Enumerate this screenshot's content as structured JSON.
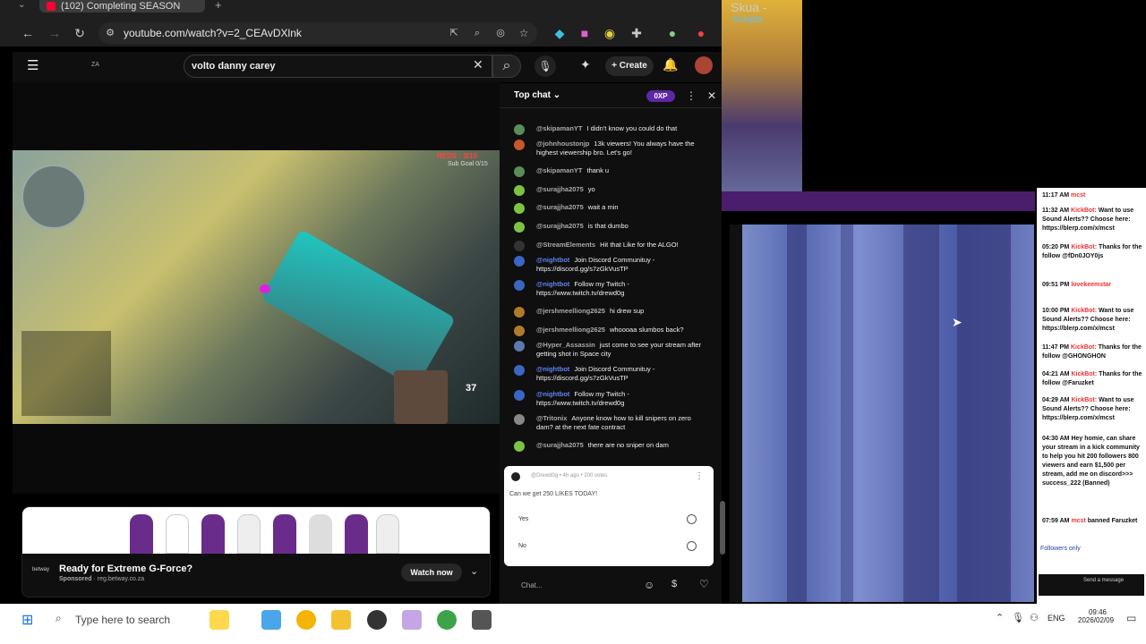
{
  "browser": {
    "tab_title": "(102) Completing SEASON",
    "url": "youtube.com/watch?v=2_CEAvDXlnk"
  },
  "youtube": {
    "search_value": "volto danny carey",
    "create_label": "Create",
    "logo_text": "ZA"
  },
  "video": {
    "reds_label": "REDS : 3/10",
    "sub_goal": "Sub Goal 0/15",
    "ammo": "37"
  },
  "ad": {
    "title": "Ready for Extreme G-Force?",
    "sponsored": "Sponsored",
    "domain": "reg.betway.co.za",
    "watch_label": "Watch now",
    "brand": "betway"
  },
  "chat": {
    "header": "Top chat",
    "xp_badge": "0XP",
    "messages": [
      {
        "author": "@skipamanYT",
        "text": "I didn't know you could do that",
        "color": "#5b8c5a"
      },
      {
        "author": "@johnhoustonjp",
        "text": "13k viewers! You always have the highest viewership bro. Let's go!",
        "color": "#c9582c"
      },
      {
        "author": "@skipamanYT",
        "text": "thank u",
        "color": "#5b8c5a"
      },
      {
        "author": "@surajjha2075",
        "text": "yo",
        "color": "#7cc342"
      },
      {
        "author": "@surajjha2075",
        "text": "wait a min",
        "color": "#7cc342"
      },
      {
        "author": "@surajjha2075",
        "text": "is that dumbo",
        "color": "#7cc342"
      },
      {
        "author": "@StreamElements",
        "text": "Hit that Like for the ALGO!",
        "color": "#333"
      },
      {
        "author": "@nightbot",
        "text": "Join Discord Communituy - https://discord.gg/s7zGkVusTP",
        "color": "#3a66c4"
      },
      {
        "author": "@nightbot",
        "text": "Follow my Twitch - https://www.twitch.tv/drewd0g",
        "color": "#3a66c4"
      },
      {
        "author": "@jershmeelliong2625",
        "text": "hi drew sup",
        "color": "#b07b2a"
      },
      {
        "author": "@jershmeelliong2625",
        "text": "whoooaa slumbos back?",
        "color": "#b07b2a"
      },
      {
        "author": "@Hyper_Assassin",
        "text": "just come to see your stream after getting shot in Space city",
        "color": "#5b7bb0"
      },
      {
        "author": "@nightbot",
        "text": "Join Discord Communituy - https://discord.gg/s7zGkVusTP",
        "color": "#3a66c4"
      },
      {
        "author": "@nightbot",
        "text": "Follow my Twitch - https://www.twitch.tv/drewd0g",
        "color": "#3a66c4"
      },
      {
        "author": "@Tritonix",
        "text": "Anyone know how to kill snipers on zero dam? at the next fate contract",
        "color": "#888"
      },
      {
        "author": "@surajjha2075",
        "text": "there are no sniper on dam",
        "color": "#7cc342"
      }
    ],
    "poll": {
      "header": "@Drewd0g • 4h ago • 200 votes",
      "question": "Can we get 250 LIKES TODAY!",
      "options": [
        "Yes",
        "No"
      ]
    },
    "input_placeholder": "Chat..."
  },
  "game_window": {
    "title": "Skua -",
    "menu": "Scripts"
  },
  "kick_chat": {
    "lines": [
      {
        "time": "11:17 AM",
        "user": "mcst",
        "text": ""
      },
      {
        "time": "11:32 AM",
        "user": "KickBot:",
        "text": "Want to use Sound Alerts?? Choose here: https://blerp.com/x/mcst"
      },
      {
        "time": "05:20 PM",
        "user": "KickBot:",
        "text": "Thanks for the follow @fDn0JOY0js"
      },
      {
        "time": "09:51 PM",
        "user": "lovekeemstar",
        "text": ""
      },
      {
        "time": "10:00 PM",
        "user": "KickBot:",
        "text": "Want to use Sound Alerts?? Choose here: https://blerp.com/x/mcst"
      },
      {
        "time": "11:47 PM",
        "user": "KickBot:",
        "text": "Thanks for the follow @GHONGHON"
      },
      {
        "time": "04:21 AM",
        "user": "KickBot:",
        "text": "Thanks for the follow @Faruzket"
      },
      {
        "time": "04:29 AM",
        "user": "KickBot:",
        "text": "Want to use Sound Alerts?? Choose here: https://blerp.com/x/mcst"
      },
      {
        "time": "04:30 AM",
        "user": "",
        "text": "Hey homie, can share your stream in a kick community to help you hit 200 followers 800 viewers and earn $1,500 per stream, add me on discord>>> success_222 (Banned)"
      },
      {
        "time": "07:59 AM",
        "user": "mcst",
        "text": "banned Faruzket"
      }
    ],
    "followers_only": "Followers only",
    "send_label": "Send a message"
  },
  "taskbar": {
    "search_placeholder": "Type here to search",
    "time": "09:46",
    "date": "2026/02/09",
    "lang": "ENG"
  },
  "colors": {
    "youtube_bg": "#0f0f0f",
    "xp_purple": "#5f26a5",
    "link_blue": "#1b3fa6"
  }
}
